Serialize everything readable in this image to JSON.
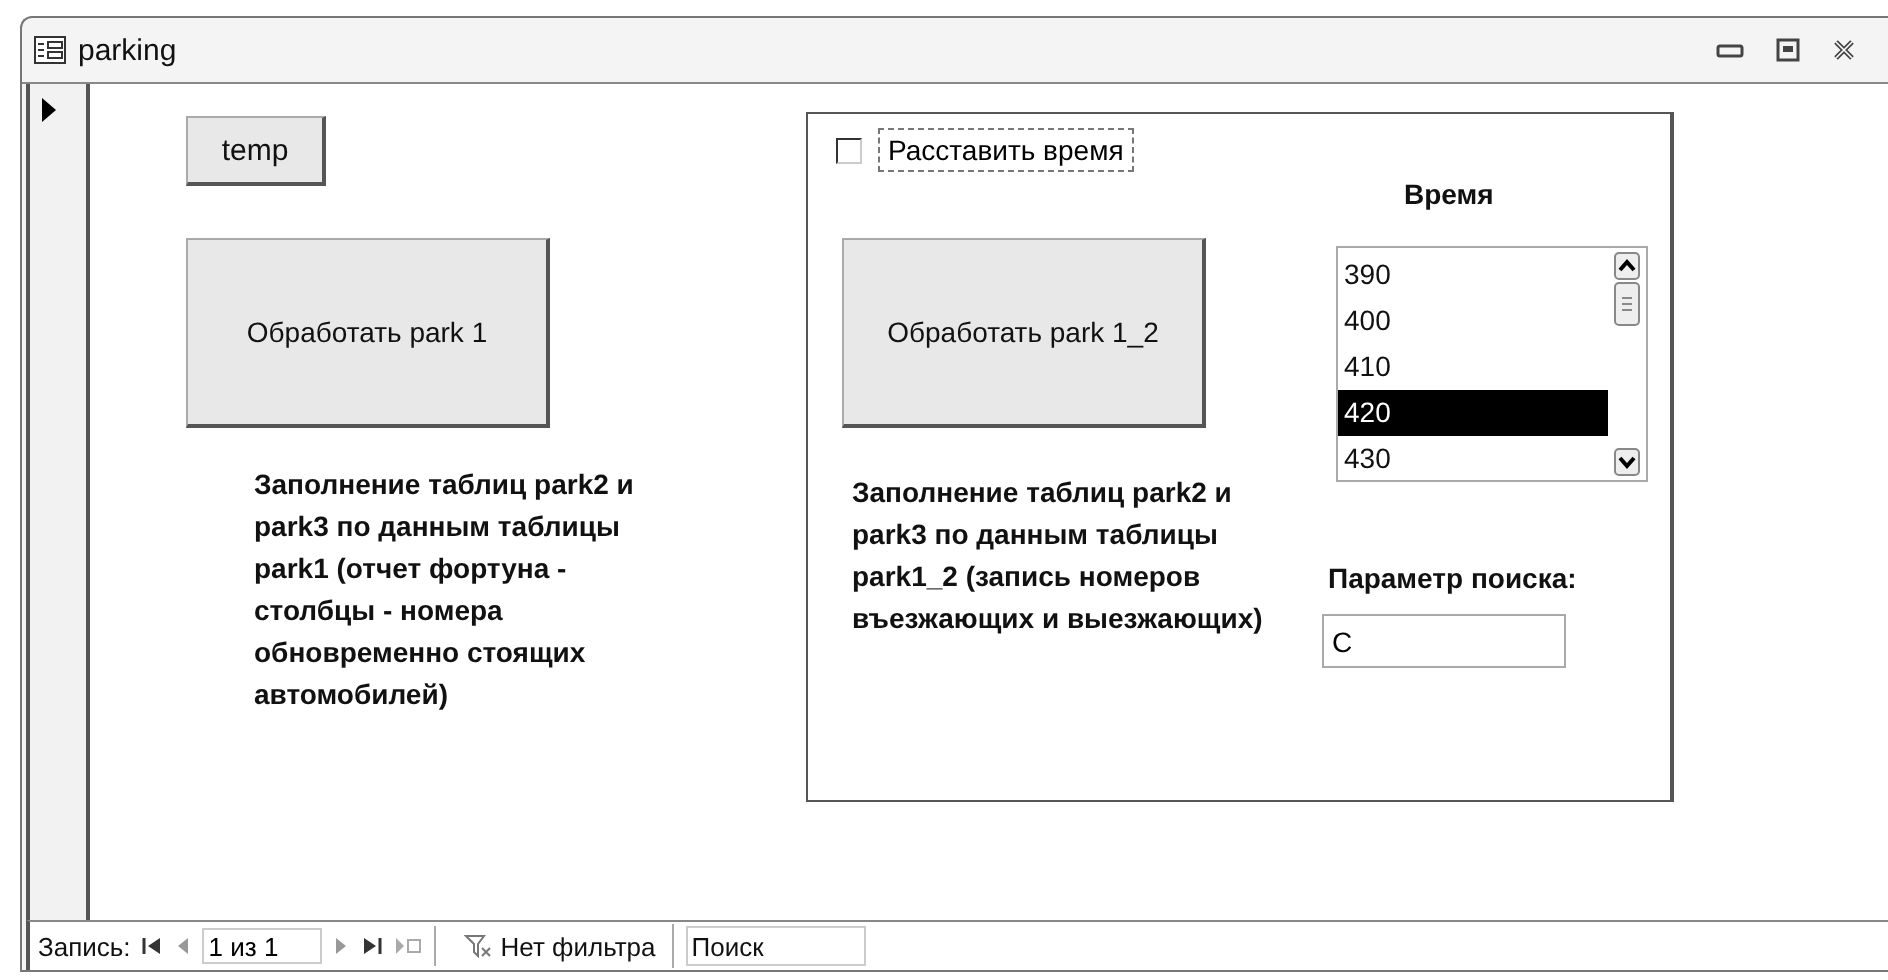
{
  "window": {
    "title": "parking"
  },
  "left": {
    "small_button": "temp",
    "button": "Обработать park 1",
    "description": "Заполнение таблиц park2 и park3 по данным таблицы park1 (отчет фортуна - столбцы - номера обновременно стоящих автомобилей)"
  },
  "group": {
    "checkbox": {
      "label": "Расставить время",
      "checked": false
    },
    "button": "Обработать park 1_2",
    "description": "Заполнение таблиц park2 и park3 по данным таблицы park1_2 (запись номеров въезжающих и выезжающих)",
    "list": {
      "label": "Время",
      "items": [
        {
          "text": "390",
          "selected": false
        },
        {
          "text": "400",
          "selected": false
        },
        {
          "text": "410",
          "selected": false
        },
        {
          "text": "420",
          "selected": true
        },
        {
          "text": "430",
          "selected": false
        }
      ]
    },
    "search": {
      "label": "Параметр поиска:",
      "value": "С"
    }
  },
  "navigation": {
    "label": "Запись:",
    "position": "1 из 1",
    "filter": "Нет фильтра",
    "search_placeholder": "Поиск"
  }
}
